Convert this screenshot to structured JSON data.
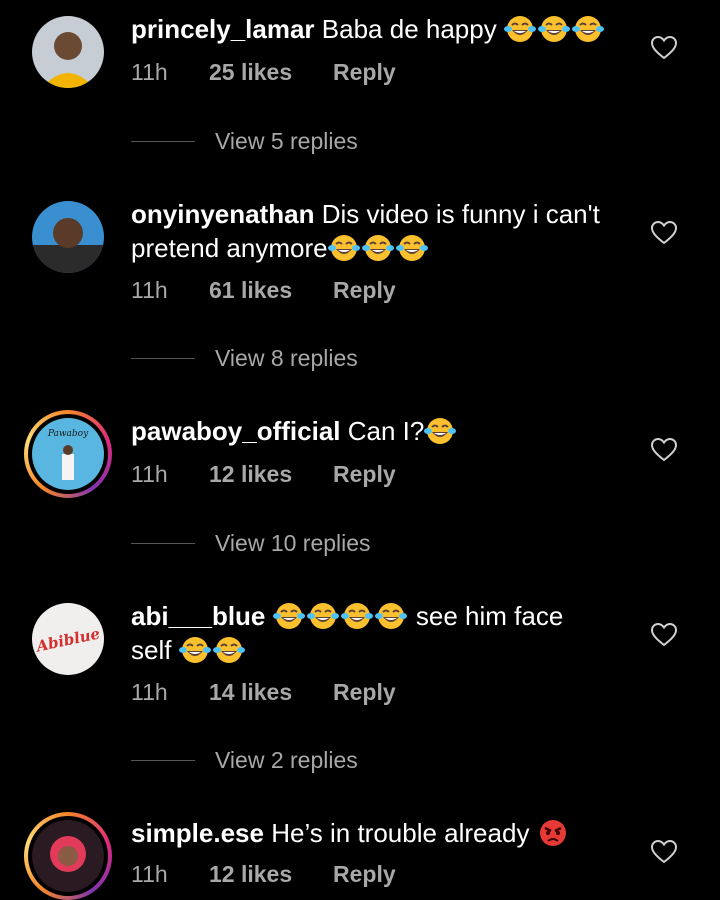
{
  "comments": [
    {
      "username": "princely_lamar",
      "text": "Baba de happy",
      "emojis_after": 3,
      "time": "11h",
      "likes": "25 likes",
      "reply": "Reply",
      "view_replies": "View 5 replies"
    },
    {
      "username": "onyinyenathan",
      "text": "Dis video is funny i can't pretend anymore",
      "emojis_after": 3,
      "time": "11h",
      "likes": "61 likes",
      "reply": "Reply",
      "view_replies": "View 8 replies"
    },
    {
      "username": "pawaboy_official",
      "text": "Can I?",
      "emojis_after": 1,
      "avatar_text": "Pawaboy",
      "time": "11h",
      "likes": "12 likes",
      "reply": "Reply",
      "view_replies": "View 10 replies"
    },
    {
      "username": "abi___blue",
      "text_after_emojis": "see him face",
      "text_line2": "self",
      "emojis_mid": 4,
      "emojis_end": 2,
      "avatar_text": "Abiblue",
      "time": "11h",
      "likes": "14 likes",
      "reply": "Reply",
      "view_replies": "View 2 replies"
    },
    {
      "username": "simple.ese",
      "text": "He’s in trouble already",
      "emoji_end": "angry-face",
      "time": "11h",
      "likes": "12 likes",
      "reply": "Reply"
    }
  ],
  "icons": {
    "like": "heart-outline-icon",
    "laugh": "face-with-tears-of-joy-emoji"
  },
  "colors": {
    "background": "#000000",
    "muted": "#a8a8a8",
    "text": "#ffffff"
  }
}
